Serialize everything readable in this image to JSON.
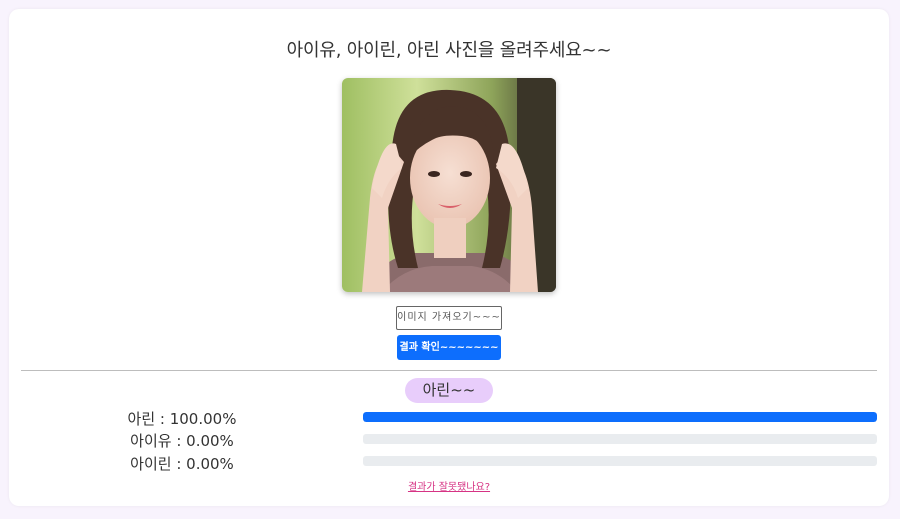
{
  "page": {
    "title": "아이유, 아이린, 아린 사진을 올려주세요~~"
  },
  "upload": {
    "file_button_label": "이미지 가져오기~~~",
    "check_button_label": "결과 확인~~~~~~~",
    "photo_alt": "업로드된 인물 사진"
  },
  "result": {
    "top_label": "아린~~",
    "rows": [
      {
        "label": "아린 : 100.00%",
        "value": 100.0
      },
      {
        "label": "아이유 : 0.00%",
        "value": 0.0
      },
      {
        "label": "아이린 : 0.00%",
        "value": 0.0
      }
    ],
    "wrong_link": "결과가 잘못됐나요?"
  },
  "colors": {
    "accent": "#0d6efd",
    "badge": "#e8cdfb",
    "link": "#d63384",
    "page_bg": "#f8f3fd"
  }
}
